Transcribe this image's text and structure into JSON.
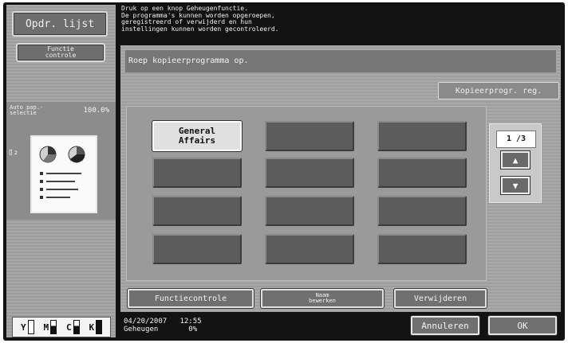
{
  "sidebar": {
    "job_list_button": "Opdr. lijst",
    "function_check_button": "Functie\ncontrole",
    "auto_paper": {
      "label": "Auto pap.-\nselectie",
      "zoom": "100.0%"
    },
    "toner": [
      {
        "letter": "Y"
      },
      {
        "letter": "M"
      },
      {
        "letter": "C"
      },
      {
        "letter": "K"
      }
    ]
  },
  "message": "Druk op een knop Geheugenfunctie.\nDe programma's kunnen worden opgeroepen,\ngeregistreerd of verwijderd en hun\ninstellingen kunnen worden gecontroleerd.",
  "main": {
    "title": "Roep kopieerprogramma op.",
    "register_button": "Kopieerprogr. reg.",
    "programs": [
      {
        "label": "General\nAffairs"
      },
      {
        "label": ""
      },
      {
        "label": ""
      },
      {
        "label": ""
      },
      {
        "label": ""
      },
      {
        "label": ""
      },
      {
        "label": ""
      },
      {
        "label": ""
      },
      {
        "label": ""
      },
      {
        "label": ""
      },
      {
        "label": ""
      },
      {
        "label": ""
      }
    ],
    "pager": {
      "count": "1 /3",
      "up": "▲",
      "down": "▼"
    },
    "buttons": {
      "function_check": "Functiecontrole",
      "edit_name": "Naam\nbewerken",
      "delete": "Verwijderen"
    }
  },
  "footer": {
    "datetime": "04/20/2007   12:55\nGeheugen       0%",
    "cancel": "Annuleren",
    "ok": "OK"
  }
}
